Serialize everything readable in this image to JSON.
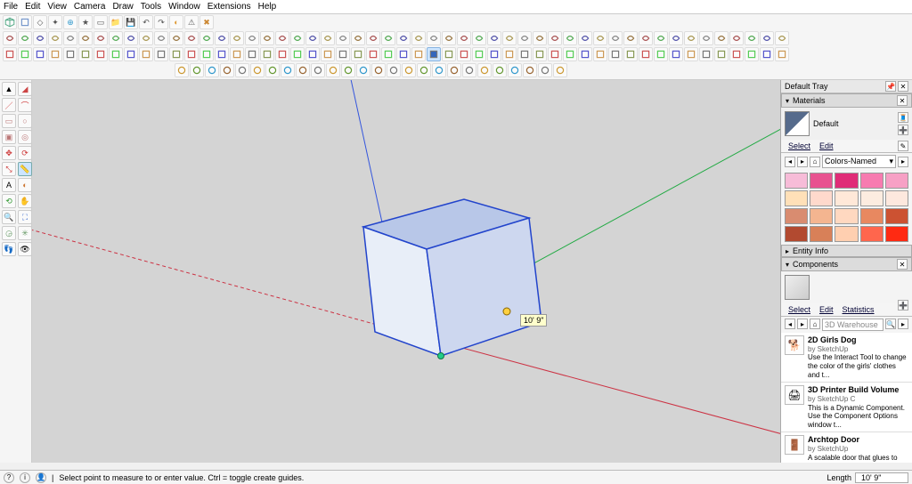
{
  "menu": [
    "File",
    "Edit",
    "View",
    "Camera",
    "Draw",
    "Tools",
    "Window",
    "Extensions",
    "Help"
  ],
  "tray": {
    "title": "Default Tray",
    "materials": {
      "label": "Materials",
      "current_name": "Default",
      "tabs": [
        "Select",
        "Edit"
      ],
      "library": "Colors-Named",
      "swatches": [
        "#f7bcd8",
        "#e85290",
        "#e02c77",
        "#f77bb0",
        "#f7a0c5",
        "#ffe0b8",
        "#ffd9cc",
        "#ffe8d8",
        "#fcece0",
        "#fde8de",
        "#d98c70",
        "#f4b590",
        "#ffd8c0",
        "#e88860",
        "#cc5232",
        "#b24a30",
        "#d88058",
        "#ffcfb0",
        "#ff664d",
        "#ff2a12"
      ]
    },
    "entity_info": {
      "label": "Entity Info"
    },
    "components": {
      "label": "Components",
      "tabs": [
        "Select",
        "Edit",
        "Statistics"
      ],
      "search_placeholder": "3D Warehouse",
      "items": [
        {
          "title": "2D Girls Dog",
          "by": "by SketchUp",
          "desc": "Use the Interact Tool to change the color of the girls' clothes and t..."
        },
        {
          "title": "3D Printer Build Volume",
          "by": "by SketchUp C",
          "desc": "This is a Dynamic Component. Use the Component Options window t..."
        },
        {
          "title": "Archtop Door",
          "by": "by SketchUp",
          "desc": "A scalable door that glues to walls and cuts a hole through them..."
        }
      ]
    }
  },
  "viewport": {
    "dimension_label": "10' 9\""
  },
  "status": {
    "hint": "Select point to measure to or enter value. Ctrl = toggle create guides.",
    "length_label": "Length",
    "length_value": "10' 9\""
  },
  "chart_data": {
    "type": "table",
    "note": "3D viewport - isometric cube with RGB axes; no numeric chart data",
    "axes": {
      "x": "red",
      "y": "green",
      "z": "blue"
    }
  }
}
